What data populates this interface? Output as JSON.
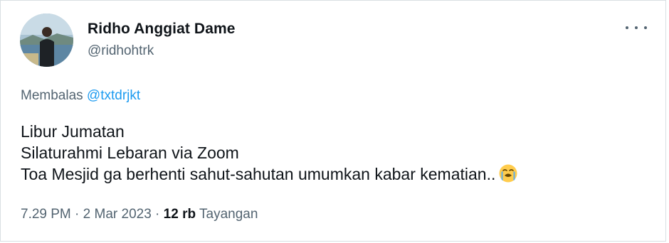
{
  "author": {
    "name": "Ridho Anggiat Dame",
    "handle": "@ridhohtrk"
  },
  "reply": {
    "prefix": "Membalas ",
    "mention": "@txtdrjkt"
  },
  "tweet": {
    "lines": [
      "Libur Jumatan",
      "Silaturahmi Lebaran via Zoom",
      "Toa Mesjid ga berhenti sahut-sahutan umumkan kabar kematian.."
    ],
    "emoji": "loudly-crying-face-emoji"
  },
  "meta": {
    "time": "7.29 PM",
    "separator1": " · ",
    "date": "2 Mar 2023",
    "separator2": " · ",
    "views_count": "12 rb",
    "views_label": " Tayangan"
  },
  "icons": {
    "more": "more-horizontal-icon"
  },
  "colors": {
    "text_primary": "#0f1419",
    "text_secondary": "#536471",
    "link": "#1d9bf0",
    "border": "#d9dfe3"
  }
}
